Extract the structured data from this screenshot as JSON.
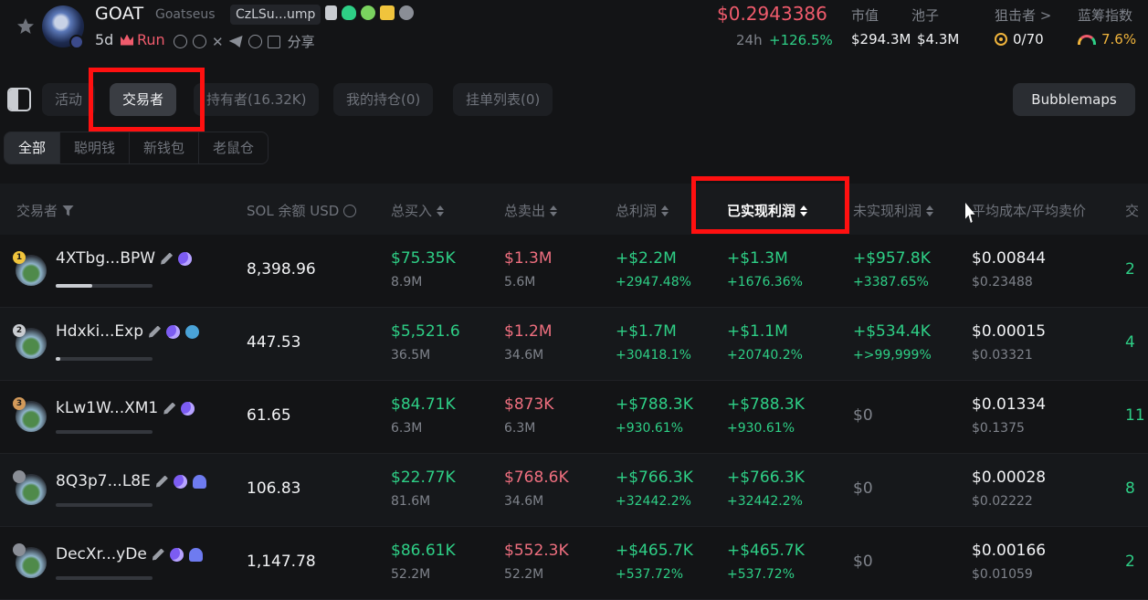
{
  "header": {
    "symbol": "GOAT",
    "name": "Goatseus",
    "contract": "CzLSu...ump",
    "age": "5d",
    "run_label": "Run",
    "share_label": "分享",
    "price": "$0.2943386",
    "change_label": "24h",
    "change_value": "+126.5%",
    "market_cap_label": "市值",
    "market_cap_value": "$294.3M",
    "pool_label": "池子",
    "pool_value": "$4.3M",
    "sniper_label": "狙击者 >",
    "sniper_value": "0/70",
    "bluechip_label": "蓝筹指数",
    "bluechip_value": "7.6%"
  },
  "tabs": [
    {
      "label": "活动"
    },
    {
      "label": "交易者"
    },
    {
      "label": "持有者(16.32K)"
    },
    {
      "label": "我的持仓(0)"
    },
    {
      "label": "挂单列表(0)"
    }
  ],
  "bubblemaps_label": "Bubblemaps",
  "filters": [
    {
      "label": "全部"
    },
    {
      "label": "聪明钱"
    },
    {
      "label": "新钱包"
    },
    {
      "label": "老鼠仓"
    }
  ],
  "columns": {
    "trader": "交易者",
    "balance": "SOL 余额 USD",
    "bought": "总买入",
    "sold": "总卖出",
    "pnl": "总利润",
    "realized": "已实现利润",
    "unrealized": "未实现利润",
    "avg": "平均成本/平均卖价",
    "extra": "交"
  },
  "rows": [
    {
      "rank": "1",
      "rank_color": "#f0c43c",
      "address": "4XTbg...BPW",
      "bar_fraction": 0.38,
      "balance": "8,398.96",
      "bought": "$75.35K",
      "bought_tokens": "8.9M",
      "sold": "$1.3M",
      "sold_tokens": "5.6M",
      "pnl": "+$2.2M",
      "pnl_pct": "+2947.48%",
      "realized": "+$1.3M",
      "realized_pct": "+1676.36%",
      "unrealized": "+$957.8K",
      "unrealized_pct": "+3387.65%",
      "avg_cost": "$0.00844",
      "avg_sell": "$0.23488",
      "extra": "2"
    },
    {
      "rank": "2",
      "rank_color": "#c9ccd1",
      "address": "Hdxki...Exp",
      "bar_fraction": 0.05,
      "balance": "447.53",
      "bought": "$5,521.6",
      "bought_tokens": "36.5M",
      "sold": "$1.2M",
      "sold_tokens": "34.6M",
      "pnl": "+$1.7M",
      "pnl_pct": "+30418.1%",
      "realized": "+$1.1M",
      "realized_pct": "+20740.2%",
      "unrealized": "+$534.4K",
      "unrealized_pct": "+>99,999%",
      "avg_cost": "$0.00015",
      "avg_sell": "$0.03321",
      "extra": "4"
    },
    {
      "rank": "3",
      "rank_color": "#d39a5a",
      "address": "kLw1W...XM1",
      "bar_fraction": 0.0,
      "balance": "61.65",
      "bought": "$84.71K",
      "bought_tokens": "6.3M",
      "sold": "$873K",
      "sold_tokens": "6.3M",
      "pnl": "+$788.3K",
      "pnl_pct": "+930.61%",
      "realized": "+$788.3K",
      "realized_pct": "+930.61%",
      "unrealized": "$0",
      "unrealized_pct": "",
      "avg_cost": "$0.01334",
      "avg_sell": "$0.1375",
      "extra": "11"
    },
    {
      "rank": "",
      "rank_color": "#8a8e96",
      "address": "8Q3p7...L8E",
      "bar_fraction": 0.0,
      "balance": "106.83",
      "bought": "$22.77K",
      "bought_tokens": "81.6M",
      "sold": "$768.6K",
      "sold_tokens": "34.6M",
      "pnl": "+$766.3K",
      "pnl_pct": "+32442.2%",
      "realized": "+$766.3K",
      "realized_pct": "+32442.2%",
      "unrealized": "$0",
      "unrealized_pct": "",
      "avg_cost": "$0.00028",
      "avg_sell": "$0.02222",
      "extra": "8"
    },
    {
      "rank": "",
      "rank_color": "#8a8e96",
      "address": "DecXr...yDe",
      "bar_fraction": 0.0,
      "balance": "1,147.78",
      "bought": "$86.61K",
      "bought_tokens": "52.2M",
      "sold": "$552.3K",
      "sold_tokens": "52.2M",
      "pnl": "+$465.7K",
      "pnl_pct": "+537.72%",
      "realized": "+$465.7K",
      "realized_pct": "+537.72%",
      "unrealized": "$0",
      "unrealized_pct": "",
      "avg_cost": "$0.00166",
      "avg_sell": "$0.01059",
      "extra": "2"
    }
  ]
}
